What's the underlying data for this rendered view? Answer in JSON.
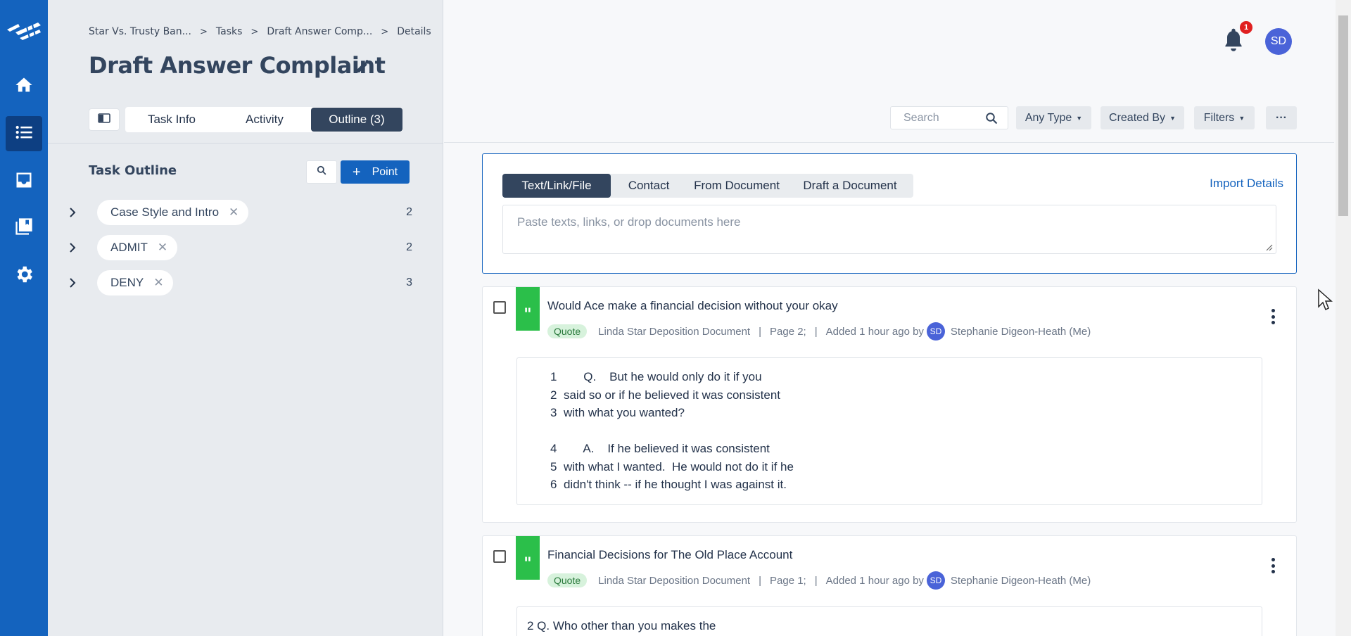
{
  "breadcrumb": {
    "items": [
      "Star Vs. Trusty Ban...",
      "Tasks",
      "Draft Answer Comp...",
      "Details"
    ],
    "sep": ">"
  },
  "page_title": "Draft Answer Complaint",
  "tabs": [
    "Task Info",
    "Activity",
    "Outline (3)"
  ],
  "active_tab": "Outline (3)",
  "outline": {
    "title": "Task Outline",
    "point_label": "Point",
    "items": [
      {
        "label": "Case Style and Intro",
        "count": "2"
      },
      {
        "label": "ADMIT",
        "count": "2"
      },
      {
        "label": "DENY",
        "count": "3"
      }
    ]
  },
  "header": {
    "notification_count": "1",
    "avatar_initials": "SD"
  },
  "filters": {
    "search_placeholder": "Search",
    "any_type": "Any Type",
    "created_by": "Created By",
    "filters": "Filters",
    "more": "···"
  },
  "composer": {
    "segments": [
      "Text/Link/File",
      "Contact",
      "From Document",
      "Draft a Document"
    ],
    "active_segment": "Text/Link/File",
    "import_details": "Import Details",
    "paste_placeholder": "Paste texts, links, or drop documents here"
  },
  "cards": [
    {
      "title": "Would Ace make a financial decision without your okay",
      "tag": "Quote",
      "source": "Linda Star Deposition Document",
      "page": "Page 2;",
      "added": "Added  1 hour ago by",
      "author_initials": "SD",
      "author": "Stephanie Digeon-Heath (Me)",
      "body": "       1        Q.    But he would only do it if you\n       2  said so or if he believed it was consistent\n       3  with what you wanted?\n\n       4        A.    If he believed it was consistent\n       5  with what I wanted.  He would not do it if he\n       6  didn't think -- if he thought I was against it."
    },
    {
      "title": "Financial Decisions for The Old Place Account",
      "tag": "Quote",
      "source": "Linda Star Deposition Document",
      "page": "Page 1;",
      "added": "Added  1 hour ago by",
      "author_initials": "SD",
      "author": "Stephanie Digeon-Heath (Me)",
      "body": "2 Q. Who other than you makes the"
    }
  ],
  "colors": {
    "brand_blue": "#1463be",
    "dark_slate": "#33455e",
    "quote_green": "#2bbf4a",
    "badge_red": "#e02020",
    "avatar_blue": "#4a63d8"
  },
  "icons": {
    "nav": [
      "home-icon",
      "list-icon",
      "inbox-icon",
      "library-icon",
      "gear-icon"
    ]
  }
}
